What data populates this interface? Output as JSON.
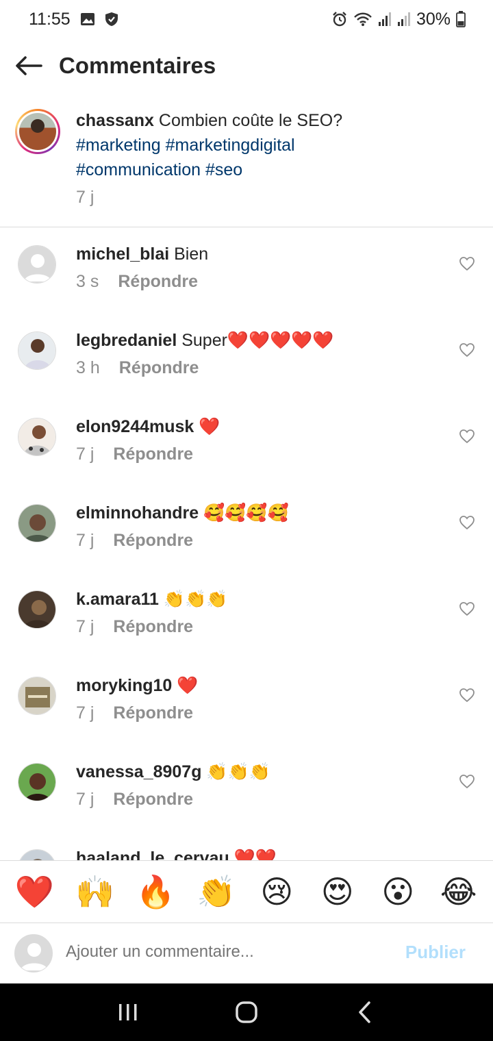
{
  "status_bar": {
    "time": "11:55",
    "battery": "30%"
  },
  "header": {
    "title": "Commentaires"
  },
  "caption": {
    "username": "chassanx",
    "text": " Combien coûte le SEO?",
    "hashtags_line1": "#marketing #marketingdigital",
    "hashtags_line2": "#communication #seo",
    "time": "7 j"
  },
  "comments": [
    {
      "username": "michel_blai",
      "text": " Bien",
      "time": "3 s",
      "reply": "Répondre"
    },
    {
      "username": "legbredaniel",
      "text": " Super❤️❤️❤️❤️❤️",
      "time": "3 h",
      "reply": "Répondre"
    },
    {
      "username": "elon9244musk",
      "text": " ❤️",
      "time": "7 j",
      "reply": "Répondre"
    },
    {
      "username": "elminnohandre",
      "text": " 🥰🥰🥰🥰",
      "time": "7 j",
      "reply": "Répondre"
    },
    {
      "username": "k.amara11",
      "text": " 👏👏👏",
      "time": "7 j",
      "reply": "Répondre"
    },
    {
      "username": "moryking10",
      "text": " ❤️",
      "time": "7 j",
      "reply": "Répondre"
    },
    {
      "username": "vanessa_8907g",
      "text": " 👏👏👏",
      "time": "7 j",
      "reply": "Répondre"
    },
    {
      "username": "haaland_le_cervau",
      "text": " ❤️❤️",
      "time": "",
      "reply": ""
    }
  ],
  "reactions": [
    "❤️",
    "🙌",
    "🔥",
    "👏",
    "😢",
    "😍",
    "😮",
    "😂"
  ],
  "composer": {
    "placeholder": "Ajouter un commentaire...",
    "publish_label": "Publier"
  },
  "colors": {
    "hashtag": "#00376b",
    "muted": "#8e8e8e",
    "publish_disabled": "#b2dffc"
  }
}
